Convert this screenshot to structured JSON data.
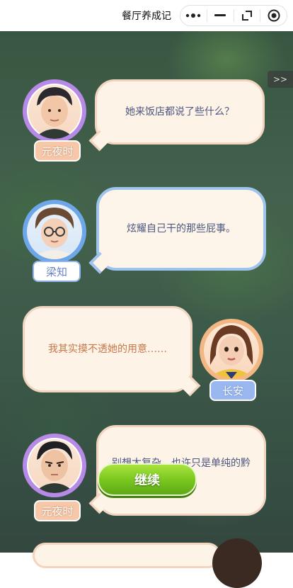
{
  "window": {
    "app_title": "餐厅养成记",
    "more_icon": "more-dots-icon",
    "minimize_icon": "minimize-icon",
    "restore_icon": "restore-icon",
    "close_icon": "target-close-icon"
  },
  "game": {
    "skip_label": ">>",
    "continue_label": "继续",
    "dialogues": [
      {
        "speaker": "元夜时",
        "text": "她来饭店都说了些什么？"
      },
      {
        "speaker": "梁知",
        "text": "炫耀自己干的那些屁事。"
      },
      {
        "speaker": "长安",
        "text": "我其实摸不透她的用意……"
      },
      {
        "speaker": "元夜时",
        "text": "别想太复杂，也许只是单纯的黔驴技穷。"
      }
    ]
  },
  "colors": {
    "accent_green": "#76c51e",
    "purple_ring": "#b68ae6",
    "blue_ring": "#6ea6ea",
    "orange_ring": "#f3b784",
    "dialogue_text": "#4d5681",
    "self_text": "#c7794b"
  }
}
